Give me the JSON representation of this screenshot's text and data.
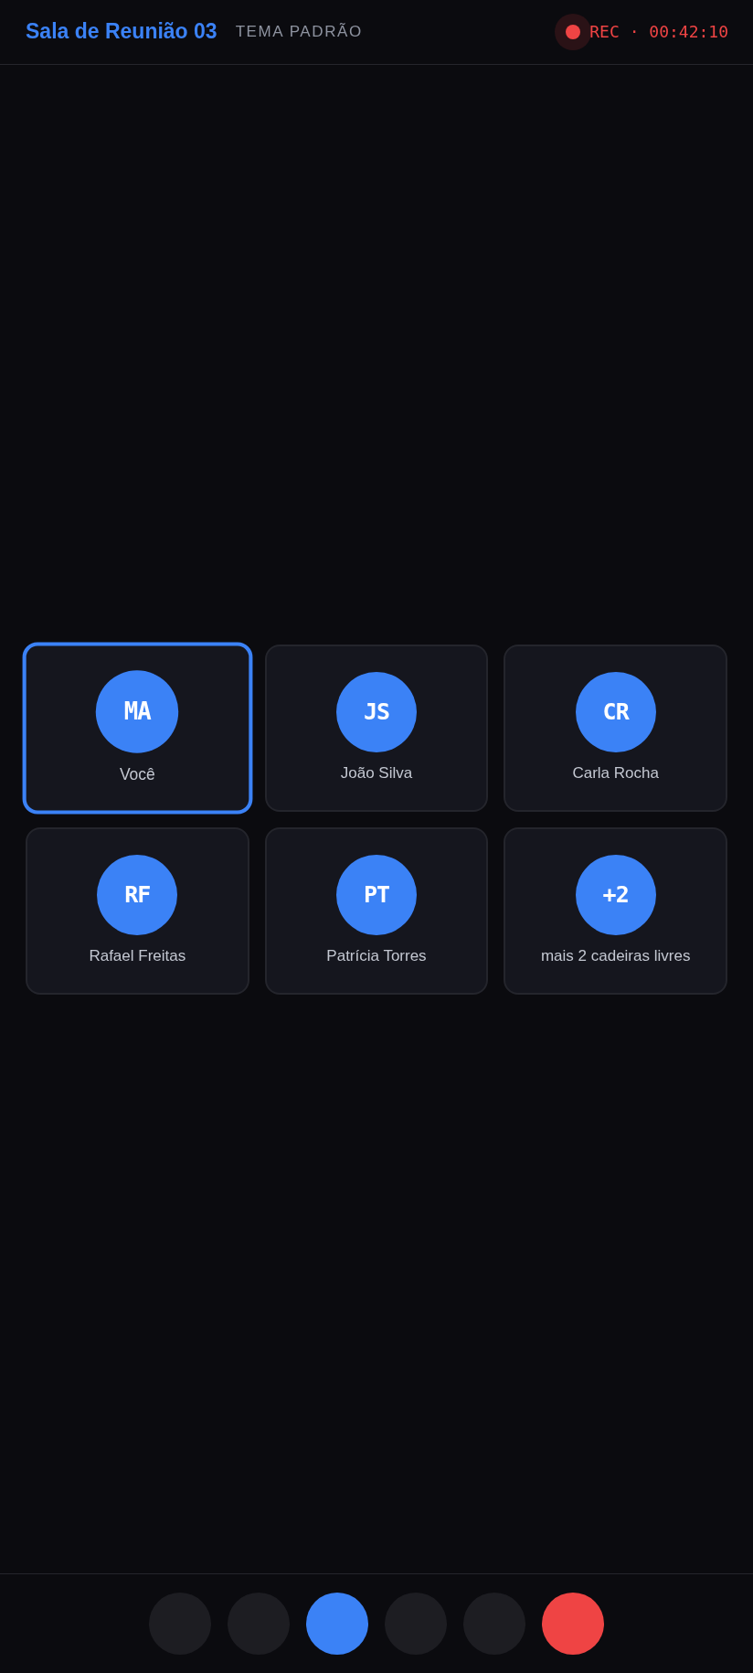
{
  "header": {
    "title": "Sala de Reunião 03",
    "theme": "TEMA PADRÃO",
    "recording": {
      "on": true,
      "label": "REC · 00:42:10"
    }
  },
  "seats": [
    {
      "initials": "MA",
      "name": "Você",
      "selected": true
    },
    {
      "initials": "JS",
      "name": "João Silva",
      "selected": false
    },
    {
      "initials": "CR",
      "name": "Carla Rocha",
      "selected": false
    },
    {
      "initials": "RF",
      "name": "Rafael Freitas",
      "selected": false
    },
    {
      "initials": "PT",
      "name": "Patrícia Torres",
      "selected": false
    },
    {
      "initials": "+2",
      "name": "mais 2 cadeiras livres",
      "selected": false
    }
  ],
  "controls": [
    {
      "kind": "neutral"
    },
    {
      "kind": "neutral"
    },
    {
      "kind": "primary"
    },
    {
      "kind": "neutral"
    },
    {
      "kind": "neutral"
    },
    {
      "kind": "danger"
    }
  ]
}
